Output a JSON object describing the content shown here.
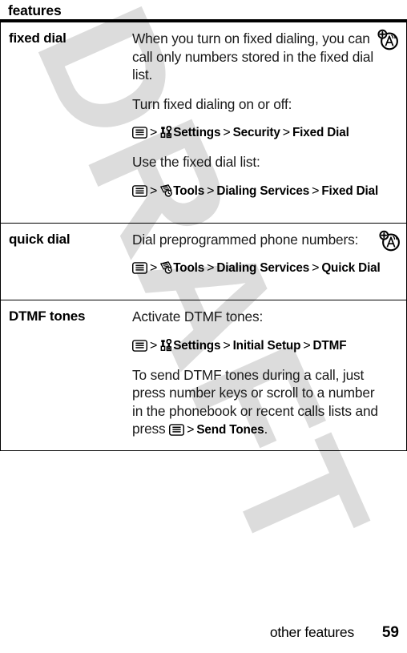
{
  "table": {
    "header_label": "features",
    "rows": [
      {
        "term": "fixed dial",
        "has_feature_icon": true,
        "feature_icon_name": "network-feature-icon",
        "blocks": [
          {
            "kind": "para",
            "text": "When you turn on fixed dialing, you can call only numbers stored in the fixed dial list."
          },
          {
            "kind": "para",
            "text": "Turn fixed dialing on or off:"
          },
          {
            "kind": "nav",
            "icons": [
              "menu-icon",
              "settings-icon"
            ],
            "items": [
              "Settings",
              "Security",
              "Fixed Dial"
            ]
          },
          {
            "kind": "para",
            "text": "Use the fixed dial list:"
          },
          {
            "kind": "nav",
            "icons": [
              "menu-icon",
              "tools-icon"
            ],
            "items": [
              "Tools",
              "Dialing Services",
              "Fixed Dial"
            ]
          }
        ]
      },
      {
        "term": "quick dial",
        "has_feature_icon": true,
        "feature_icon_name": "network-feature-icon",
        "blocks": [
          {
            "kind": "para",
            "text": "Dial preprogrammed phone numbers:"
          },
          {
            "kind": "nav",
            "icons": [
              "menu-icon",
              "tools-icon"
            ],
            "items": [
              "Tools",
              "Dialing Services",
              "Quick Dial"
            ]
          }
        ]
      },
      {
        "term": "DTMF tones",
        "has_feature_icon": false,
        "feature_icon_name": "",
        "blocks": [
          {
            "kind": "para",
            "text": "Activate DTMF tones:"
          },
          {
            "kind": "nav",
            "icons": [
              "menu-icon",
              "settings-icon"
            ],
            "items": [
              "Settings",
              "Initial Setup",
              "DTMF"
            ]
          },
          {
            "kind": "mixed",
            "lead": "To send DTMF tones during a call, just press number keys or scroll to a number in the phonebook or recent calls lists and press ",
            "icons": [
              "menu-icon"
            ],
            "items": [
              "Send Tones"
            ],
            "tail": "."
          }
        ]
      }
    ],
    "separator": ">"
  },
  "watermark": {
    "text": "DRAFT",
    "color": "#dcdcdc"
  },
  "footer": {
    "title": "other features",
    "page_number": "59"
  }
}
